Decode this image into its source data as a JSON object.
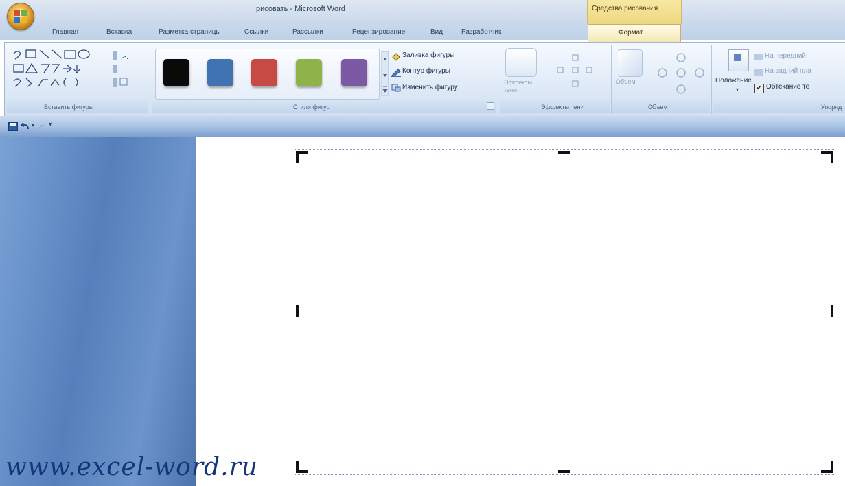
{
  "window": {
    "title": "рисовать - Microsoft Word",
    "context_title": "Средства рисования"
  },
  "tabs": [
    {
      "label": "Главная"
    },
    {
      "label": "Вставка"
    },
    {
      "label": "Разметка страницы"
    },
    {
      "label": "Ссылки"
    },
    {
      "label": "Рассылки"
    },
    {
      "label": "Рецензирование"
    },
    {
      "label": "Вид"
    },
    {
      "label": "Разработчик"
    },
    {
      "label": "Формат",
      "active": true
    }
  ],
  "ribbon": {
    "groups": {
      "insert_shapes": "Вставить фигуры",
      "shape_styles": "Стили фигур",
      "shadow_effects": "Эффекты тени",
      "volume": "Объем",
      "arrange": "Упоряд"
    },
    "shape_fill": "Заливка фигуры",
    "shape_outline": "Контур фигуры",
    "change_shape": "Изменить фигуру",
    "shadow_effects_button": "Эффекты тени",
    "volume_button": "Объем",
    "position_button": "Положение",
    "bring_front": "На передний",
    "send_back": "На задний пла",
    "text_wrap": "Обтекание те",
    "swatch_colors": [
      "#0a0a0a",
      "#3f73b2",
      "#c84a45",
      "#8fb34a",
      "#7b5aa3"
    ]
  },
  "watermark": "www.excel-word.ru"
}
